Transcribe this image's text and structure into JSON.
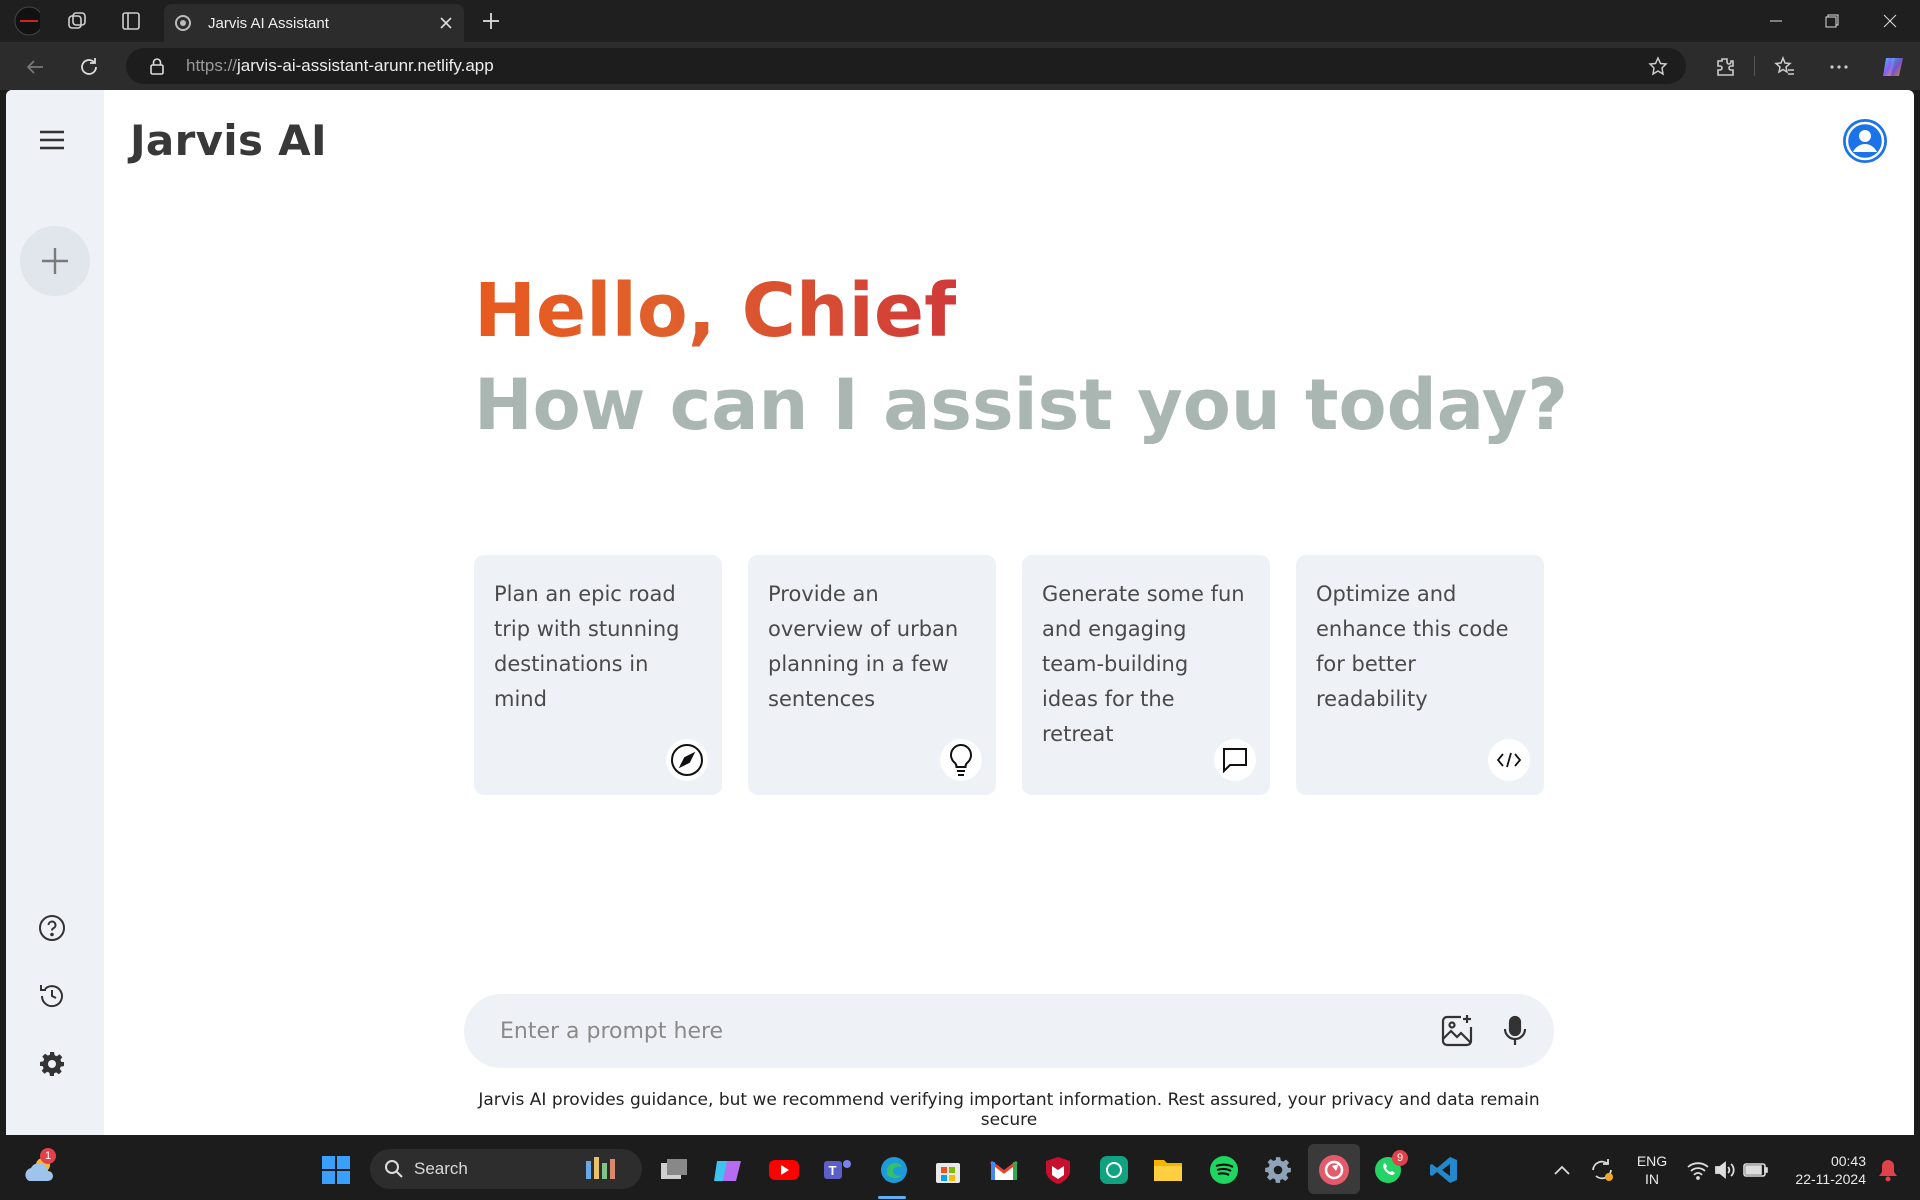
{
  "browser": {
    "tab_title": "Jarvis AI Assistant",
    "url_scheme": "https://",
    "url_host": "jarvis-ai-assistant-arunr.netlify.app"
  },
  "app": {
    "brand": "Jarvis AI",
    "greeting": "Hello, Chief",
    "subtitle": "How can I assist you today?",
    "cards": [
      {
        "text": "Plan an epic road trip with stunning destinations in mind",
        "icon": "compass-icon"
      },
      {
        "text": "Provide an overview of urban planning in a few sentences",
        "icon": "lightbulb-icon"
      },
      {
        "text": "Generate some fun and engaging team-building ideas for the retreat",
        "icon": "message-icon"
      },
      {
        "text": "Optimize and enhance this code for better readability",
        "icon": "code-icon"
      }
    ],
    "prompt_placeholder": "Enter a prompt here",
    "disclaimer": "Jarvis AI provides guidance, but we recommend verifying important information. Rest assured, your privacy and data remain secure"
  },
  "taskbar": {
    "search_label": "Search",
    "lang_1": "ENG",
    "lang_2": "IN",
    "time": "00:43",
    "date": "22-11-2024",
    "weather_badge": "1",
    "whatsapp_badge": "9"
  },
  "colors": {
    "accent_blue": "#1a73e8",
    "greeting_orange": "#e8591f",
    "greeting_red": "#d03a3a",
    "subtitle_gray": "#aab6b1",
    "card_bg": "#eef1f6"
  }
}
